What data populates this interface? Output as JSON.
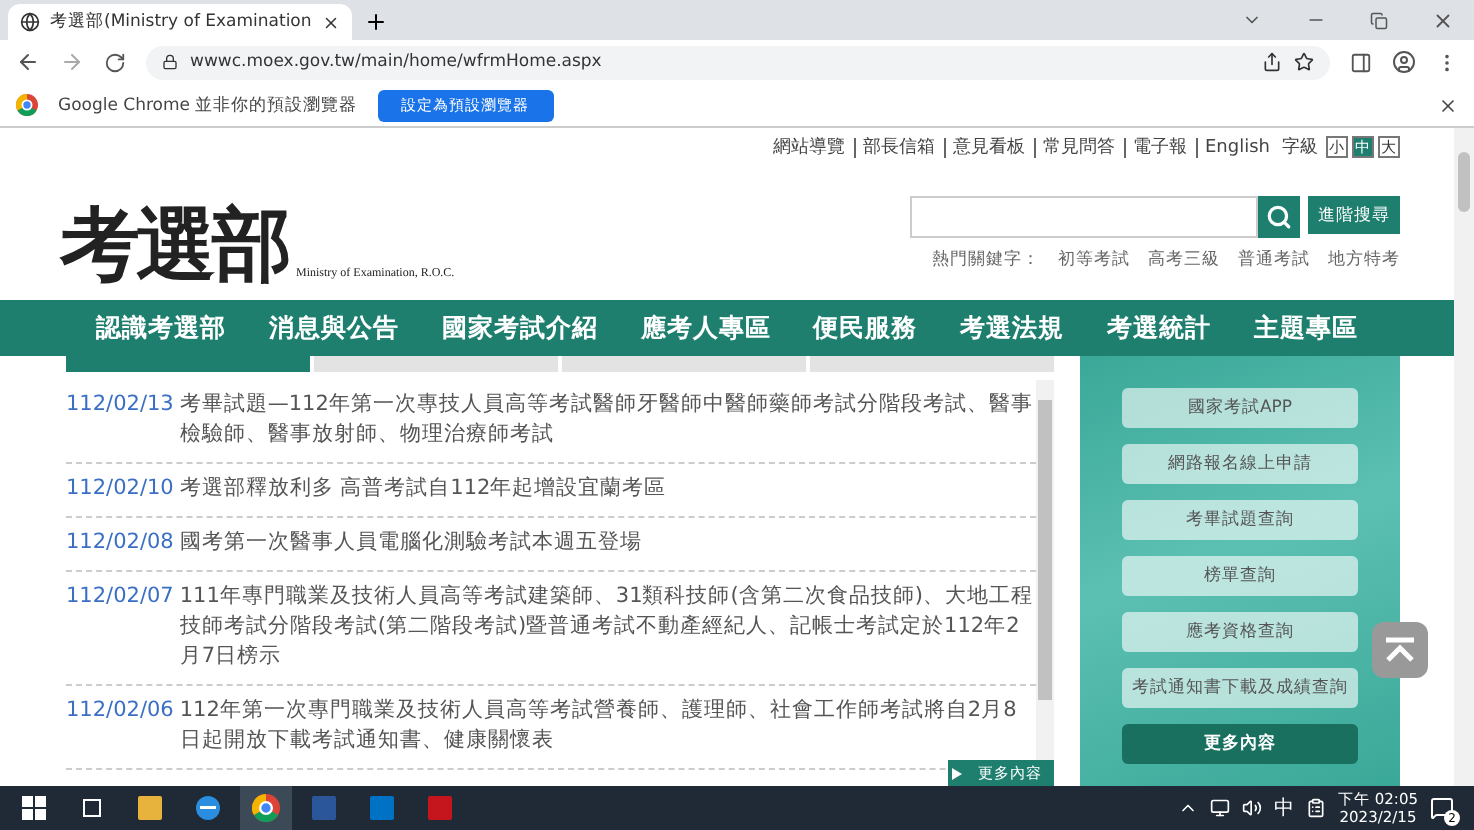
{
  "browser": {
    "tab_title": "考選部(Ministry of Examination",
    "url": "wwwc.moex.gov.tw/main/home/wfrmHome.aspx",
    "infobar": {
      "message": "Google Chrome 並非你的預設瀏覽器",
      "button": "設定為預設瀏覽器"
    }
  },
  "top_links": [
    "網站導覽",
    "部長信箱",
    "意見看板",
    "常見問答",
    "電子報",
    "English"
  ],
  "font_size": {
    "label": "字級",
    "options": [
      {
        "label": "小",
        "selected": false
      },
      {
        "label": "中",
        "selected": true
      },
      {
        "label": "大",
        "selected": false
      }
    ]
  },
  "logo": {
    "title": "考選部",
    "subtitle": "Ministry of Examination, R.O.C."
  },
  "search": {
    "advanced_button": "進階搜尋"
  },
  "hot_keywords": {
    "label": "熱門關鍵字：",
    "items": [
      "初等考試",
      "高考三級",
      "普通考試",
      "地方特考"
    ]
  },
  "nav": [
    "認識考選部",
    "消息與公告",
    "國家考試介紹",
    "應考人專區",
    "便民服務",
    "考選法規",
    "考選統計",
    "主題專區"
  ],
  "news_tabs": [
    {
      "selected": true
    },
    {
      "selected": false
    },
    {
      "selected": false
    },
    {
      "selected": false
    }
  ],
  "news": [
    {
      "date": "112/02/13",
      "text": "考畢試題—112年第一次專技人員高等考試醫師牙醫師中醫師藥師考試分階段考試、醫事檢驗師、醫事放射師、物理治療師考試"
    },
    {
      "date": "112/02/10",
      "text": "考選部釋放利多 高普考試自112年起增設宜蘭考區"
    },
    {
      "date": "112/02/08",
      "text": "國考第一次醫事人員電腦化測驗考試本週五登場"
    },
    {
      "date": "112/02/07",
      "text": "111年專門職業及技術人員高等考試建築師、31類科技師(含第二次食品技師)、大地工程技師考試分階段考試(第二階段考試)暨普通考試不動產經紀人、記帳士考試定於112年2月7日榜示"
    },
    {
      "date": "112/02/06",
      "text": "112年第一次專門職業及技術人員高等考試營養師、護理師、社會工作師考試將自2月8日起開放下載考試通知書、健康關懷表"
    }
  ],
  "news_more": "更多內容",
  "sidebar": {
    "buttons": [
      "國家考試APP",
      "網路報名線上申請",
      "考畢試題查詢",
      "榜單查詢",
      "應考資格查詢",
      "考試通知書下載及成績查詢"
    ],
    "more": "更多內容"
  },
  "taskbar": {
    "input_method": "中",
    "time": "下午 02:05",
    "date": "2023/2/15",
    "notifications": "2"
  }
}
